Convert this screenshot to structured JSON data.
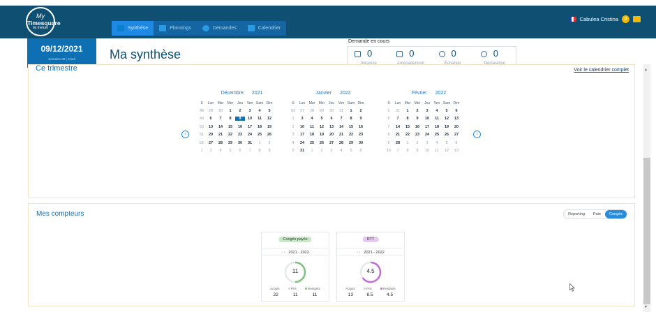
{
  "app": {
    "logo": {
      "line1": "My",
      "line2": "Timesquare",
      "line3": "by Inetum"
    },
    "user_name": "Cabulea Cristina",
    "notif_count": "0"
  },
  "nav": {
    "tabs": [
      {
        "label": "Synthèse",
        "icon": "dashboard-icon",
        "active": true
      },
      {
        "label": "Plannings",
        "icon": "planning-icon",
        "active": false
      },
      {
        "label": "Demandes",
        "icon": "demandes-icon",
        "active": false
      },
      {
        "label": "Calendrier",
        "icon": "calendar-icon",
        "active": false
      }
    ]
  },
  "date_box": {
    "date": "09/12/2021",
    "subtitle": "Semaine 49 | Jeudi"
  },
  "page_title": "Ma synthèse",
  "demandes": {
    "header": "Demande en cours",
    "items": [
      {
        "count": "0",
        "label": "Absence",
        "icon": "absence-icon"
      },
      {
        "count": "0",
        "label": "Aménagement",
        "icon": "amenagement-icon"
      },
      {
        "count": "0",
        "label": "Échange",
        "icon": "exchange-icon"
      },
      {
        "count": "0",
        "label": "Déclaration",
        "icon": "declaration-icon"
      }
    ]
  },
  "trimestre": {
    "title": "Ce trimestre",
    "link": "Voir le calendrier complet",
    "weekday_headers": [
      "S",
      "Lun",
      "Mar",
      "Mer",
      "Jeu",
      "Ven",
      "Sam",
      "Dim"
    ],
    "months": [
      {
        "month": "Décembre",
        "year": "2021",
        "rows": [
          {
            "wn": "48",
            "days": [
              "29",
              "30",
              "1",
              "2",
              "3",
              "4",
              "5"
            ],
            "other": [
              0,
              1
            ]
          },
          {
            "wn": "49",
            "days": [
              "6",
              "7",
              "8",
              "9",
              "10",
              "11",
              "12"
            ],
            "other": [],
            "today": 3
          },
          {
            "wn": "50",
            "days": [
              "13",
              "14",
              "15",
              "16",
              "17",
              "18",
              "19"
            ],
            "other": []
          },
          {
            "wn": "51",
            "days": [
              "20",
              "21",
              "22",
              "23",
              "24",
              "25",
              "26"
            ],
            "other": []
          },
          {
            "wn": "52",
            "days": [
              "27",
              "28",
              "29",
              "30",
              "31",
              "1",
              "2"
            ],
            "other": [
              5,
              6
            ]
          },
          {
            "wn": "1",
            "days": [
              "3",
              "4",
              "5",
              "6",
              "7",
              "8",
              "9"
            ],
            "other": [
              0,
              1,
              2,
              3,
              4,
              5,
              6
            ]
          }
        ]
      },
      {
        "month": "Janvier",
        "year": "2022",
        "rows": [
          {
            "wn": "52",
            "days": [
              "27",
              "28",
              "29",
              "30",
              "31",
              "1",
              "2"
            ],
            "other": [
              0,
              1,
              2,
              3,
              4
            ]
          },
          {
            "wn": "1",
            "days": [
              "3",
              "4",
              "5",
              "6",
              "7",
              "8",
              "9"
            ],
            "other": []
          },
          {
            "wn": "2",
            "days": [
              "10",
              "11",
              "12",
              "13",
              "14",
              "15",
              "16"
            ],
            "other": []
          },
          {
            "wn": "3",
            "days": [
              "17",
              "18",
              "19",
              "20",
              "21",
              "22",
              "23"
            ],
            "other": []
          },
          {
            "wn": "4",
            "days": [
              "24",
              "25",
              "26",
              "27",
              "28",
              "29",
              "30"
            ],
            "other": []
          },
          {
            "wn": "5",
            "days": [
              "31",
              "1",
              "2",
              "3",
              "4",
              "5",
              "6"
            ],
            "other": [
              1,
              2,
              3,
              4,
              5,
              6
            ]
          }
        ]
      },
      {
        "month": "Février",
        "year": "2022",
        "rows": [
          {
            "wn": "5",
            "days": [
              "31",
              "1",
              "2",
              "3",
              "4",
              "5",
              "6"
            ],
            "other": [
              0
            ]
          },
          {
            "wn": "6",
            "days": [
              "7",
              "8",
              "9",
              "10",
              "11",
              "12",
              "13"
            ],
            "other": []
          },
          {
            "wn": "7",
            "days": [
              "14",
              "15",
              "16",
              "17",
              "18",
              "19",
              "20"
            ],
            "other": []
          },
          {
            "wn": "8",
            "days": [
              "21",
              "22",
              "23",
              "24",
              "25",
              "26",
              "27"
            ],
            "other": []
          },
          {
            "wn": "9",
            "days": [
              "28",
              "1",
              "2",
              "3",
              "4",
              "5",
              "6"
            ],
            "other": [
              1,
              2,
              3,
              4,
              5,
              6
            ]
          },
          {
            "wn": "10",
            "days": [
              "7",
              "8",
              "9",
              "10",
              "11",
              "12",
              "13"
            ],
            "other": [
              0,
              1,
              2,
              3,
              4,
              5,
              6
            ]
          }
        ]
      }
    ]
  },
  "compteurs": {
    "title": "Mes compteurs",
    "segments": [
      "Reporting",
      "Paie",
      "Congés"
    ],
    "active_segment": "Congés",
    "cards": [
      {
        "tag": "Congés payés",
        "tag_color": "#c9e8c9",
        "period": "2021 - 2022",
        "value": "11",
        "ring_color": "#7cc47c",
        "ring_fraction": 0.5,
        "legend": [
          "Acquis",
          "Pris",
          "Restants"
        ],
        "values": [
          "22",
          "11",
          "11"
        ],
        "dot_color": "#7cc47c"
      },
      {
        "tag": "RTT",
        "tag_color": "#e6c9ef",
        "period": "2021 - 2022",
        "value": "4.5",
        "ring_color": "#c36fd8",
        "ring_fraction": 0.35,
        "legend": [
          "Acquis",
          "Pris",
          "Restants"
        ],
        "values": [
          "13",
          "8.5",
          "4.5"
        ],
        "dot_color": "#c36fd8"
      }
    ]
  },
  "colors": {
    "header": "#0e4f72",
    "accent": "#0e6fb3",
    "active_tab": "#1e88e5"
  }
}
